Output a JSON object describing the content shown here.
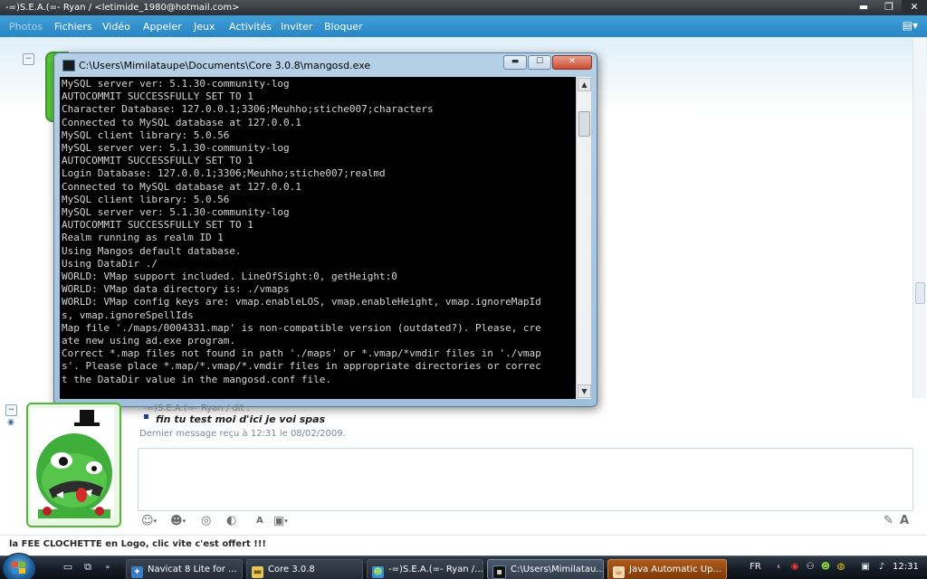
{
  "window": {
    "title": "-=)S.E.A.(=- Ryan  / <letimide_1980@hotmail.com>",
    "buttons": {
      "minimize": "▬",
      "maximize": "❐",
      "close": "✕"
    }
  },
  "menubar": {
    "items": [
      "Photos",
      "Fichiers",
      "Vidéo",
      "Appeler",
      "Jeux",
      "Activités",
      "Inviter",
      "Bloquer"
    ],
    "options_icon": "menu-options-icon"
  },
  "console": {
    "title": "C:\\Users\\Mimilataupe\\Documents\\Core 3.0.8\\mangosd.exe",
    "buttons": {
      "minimize": "▬",
      "maximize": "☐",
      "close": "✕"
    },
    "lines": [
      "MySQL server ver: 5.1.30-community-log",
      "AUTOCOMMIT SUCCESSFULLY SET TO 1",
      "Character Database: 127.0.0.1;3306;Meuhho;stiche007;characters",
      "Connected to MySQL database at 127.0.0.1",
      "MySQL client library: 5.0.56",
      "MySQL server ver: 5.1.30-community-log",
      "AUTOCOMMIT SUCCESSFULLY SET TO 1",
      "Login Database: 127.0.0.1;3306;Meuhho;stiche007;realmd",
      "Connected to MySQL database at 127.0.0.1",
      "MySQL client library: 5.0.56",
      "MySQL server ver: 5.1.30-community-log",
      "AUTOCOMMIT SUCCESSFULLY SET TO 1",
      "Realm running as realm ID 1",
      "Using Mangos default database.",
      "Using DataDir ./",
      "WORLD: VMap support included. LineOfSight:0, getHeight:0",
      "WORLD: VMap data directory is: ./vmaps",
      "WORLD: VMap config keys are: vmap.enableLOS, vmap.enableHeight, vmap.ignoreMapId",
      "s, vmap.ignoreSpellIds",
      "Map file './maps/0004331.map' is non-compatible version (outdated?). Please, cre",
      "ate new using ad.exe program.",
      "Correct *.map files not found in path './maps' or *.vmap/*vmdir files in './vmap",
      "s'. Please place *.map/*.vmap/*.vmdir files in appropriate directories or correc",
      "t the DataDir value in the mangosd.conf file."
    ]
  },
  "conversation": {
    "sender": "-=)S.E.A.(=- Ryan  / dit :",
    "message": "fin tu test moi d'ici je voi spas",
    "status": "Dernier message reçu à 12:31 le 08/02/2009."
  },
  "format_bar": {
    "items": [
      "emoticon-icon",
      "wink-icon",
      "nudge-icon",
      "voice-clip-icon",
      "font-icon",
      "background-icon"
    ],
    "right_items": [
      "handwriting-icon",
      "text-icon"
    ]
  },
  "ad": {
    "text": "la FEE CLOCHETTE en Logo, clic vite c'est offert !!!"
  },
  "taskbar": {
    "buttons": [
      {
        "label": "Navicat 8 Lite for ...",
        "icon": "navicat-icon"
      },
      {
        "label": "Core 3.0.8",
        "icon": "folder-icon"
      },
      {
        "label": "-=)S.E.A.(=- Ryan /...",
        "icon": "messenger-icon"
      },
      {
        "label": "C:\\Users\\Mimilatau...",
        "icon": "console-icon"
      },
      {
        "label": "Java Automatic Up...",
        "icon": "java-icon"
      }
    ],
    "lang": "FR",
    "clock": "12:31"
  },
  "colors": {
    "menubar": "#2f92cf",
    "console_bg": "#000000",
    "console_text": "#d4d4d4",
    "avatar_frame": "#50b834"
  }
}
